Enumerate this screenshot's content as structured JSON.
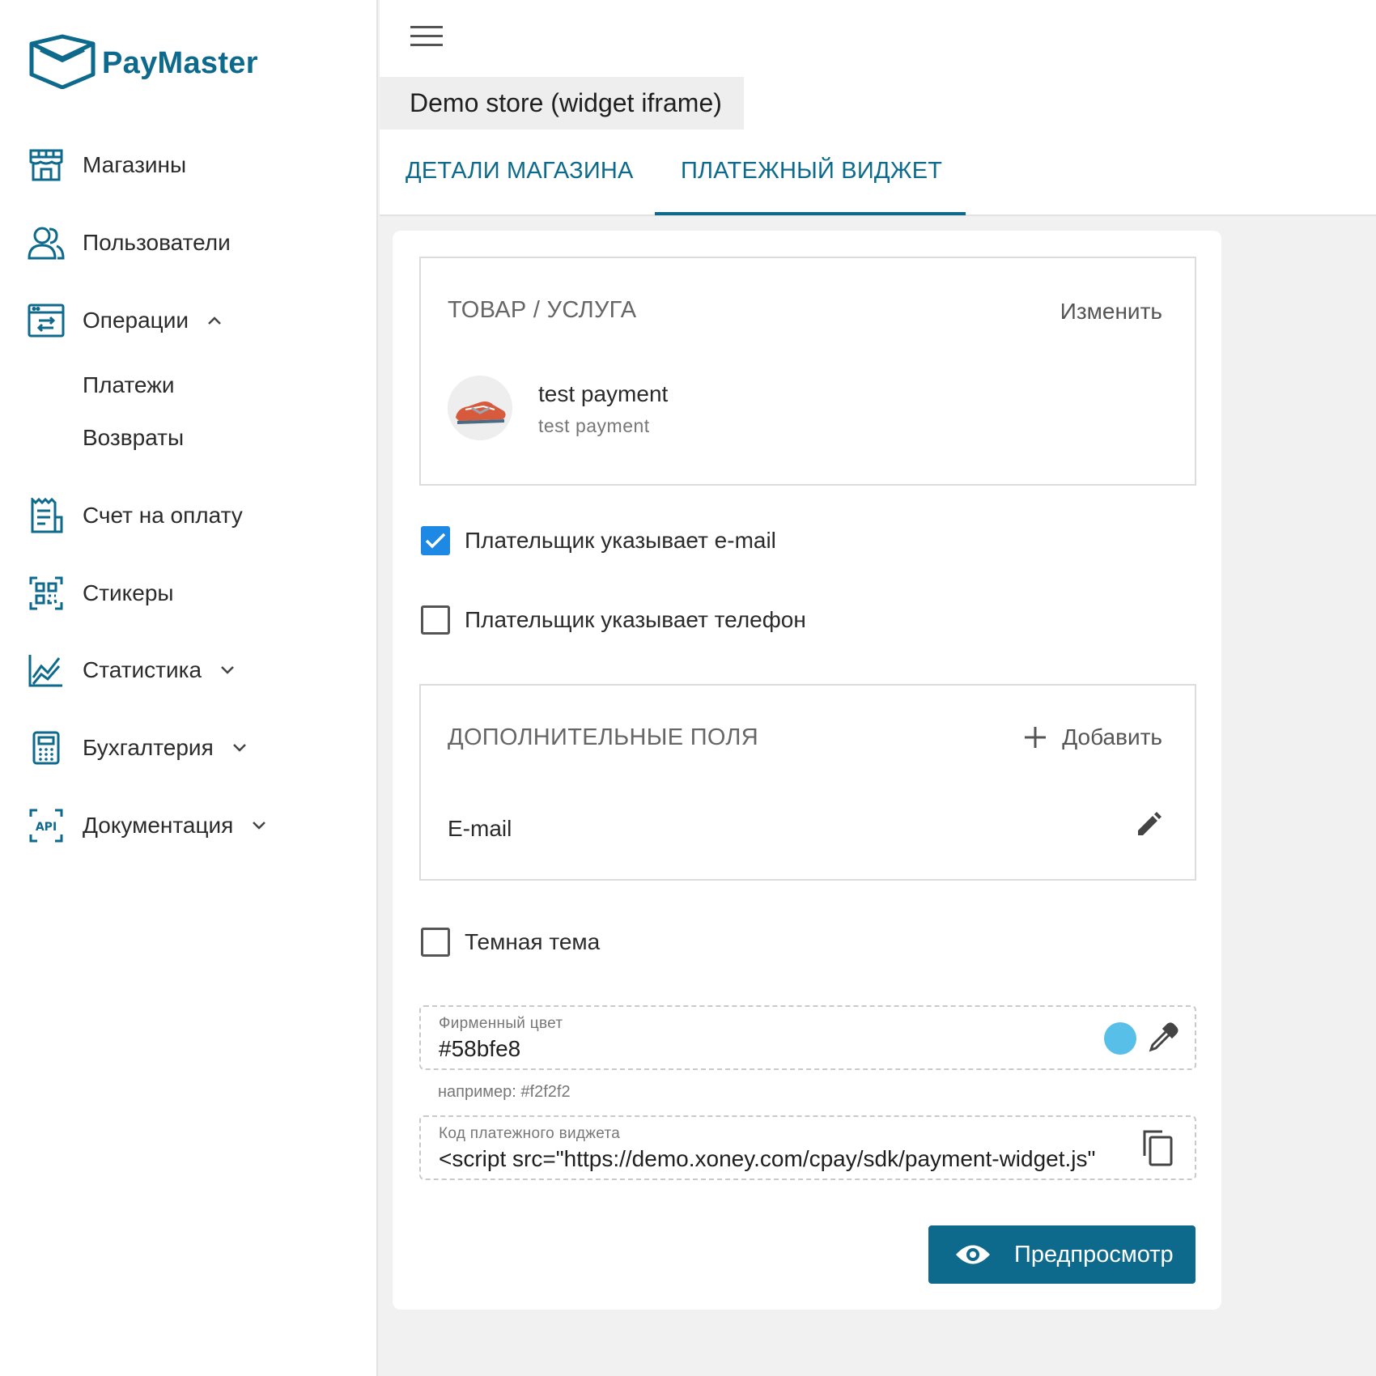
{
  "brand": {
    "name": "PayMaster",
    "color": "#0e6a8c"
  },
  "sidebar": {
    "items": [
      {
        "label": "Магазины",
        "icon": "store-icon"
      },
      {
        "label": "Пользователи",
        "icon": "users-icon"
      },
      {
        "label": "Операции",
        "icon": "operations-icon",
        "expanded": true
      },
      {
        "label": "Счет на оплату",
        "icon": "invoice-icon"
      },
      {
        "label": "Стикеры",
        "icon": "qr-icon"
      },
      {
        "label": "Статистика",
        "icon": "chart-icon",
        "expanded": false
      },
      {
        "label": "Бухгалтерия",
        "icon": "calculator-icon",
        "expanded": false
      },
      {
        "label": "Документация",
        "icon": "api-icon",
        "expanded": false
      }
    ],
    "sub_items": [
      {
        "label": "Платежи"
      },
      {
        "label": "Возвраты"
      }
    ]
  },
  "header": {
    "store_title": "Demo store (widget iframe)",
    "tabs": [
      {
        "label": "ДЕТАЛИ МАГАЗИНА",
        "active": false
      },
      {
        "label": "ПЛАТЕЖНЫЙ ВИДЖЕТ",
        "active": true
      }
    ]
  },
  "product_box": {
    "title": "ТОВАР / УСЛУГА",
    "action": "Изменить",
    "product_name": "test payment",
    "product_description": "test payment"
  },
  "options": {
    "email": {
      "label": "Плательщик указывает e-mail",
      "checked": true
    },
    "phone": {
      "label": "Плательщик указывает телефон",
      "checked": false
    },
    "dark_theme": {
      "label": "Темная тема",
      "checked": false
    }
  },
  "extra_fields": {
    "title": "ДОПОЛНИТЕЛЬНЫЕ ПОЛЯ",
    "add_label": "Добавить",
    "fields": [
      {
        "name": "E-mail"
      }
    ]
  },
  "brand_color_field": {
    "label": "Фирменный цвет",
    "value": "#58bfe8",
    "swatch": "#58bfe8",
    "hint": "например: #f2f2f2"
  },
  "widget_code_field": {
    "label": "Код платежного виджета",
    "value": "<script src=\"https://demo.xoney.com/cpay/sdk/payment-widget.js\""
  },
  "preview_button": {
    "label": "Предпросмотр"
  },
  "colors": {
    "accent": "#0e6a8c",
    "checkbox": "#1e88e5"
  }
}
